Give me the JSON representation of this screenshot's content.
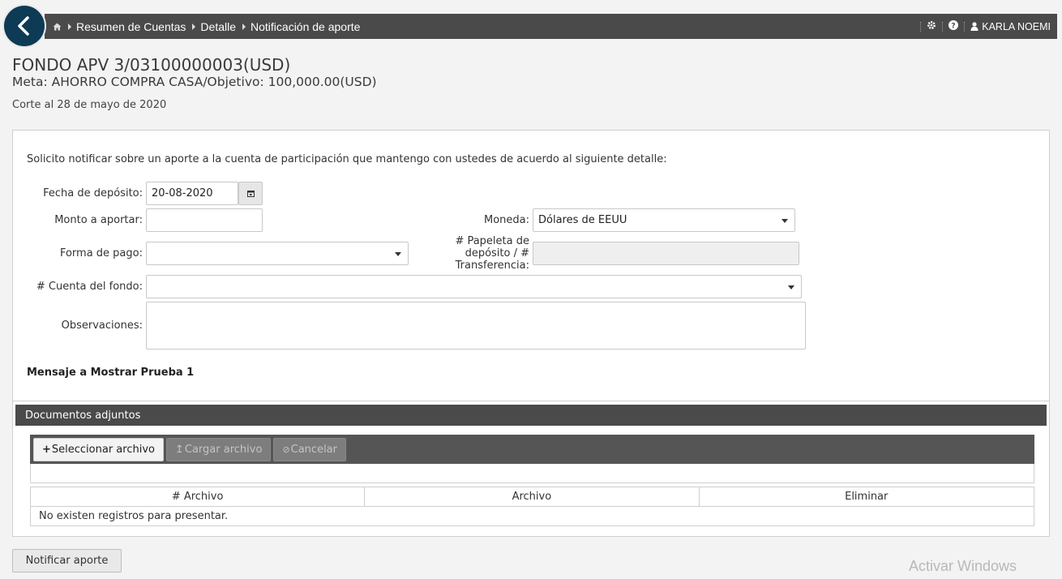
{
  "nav": {
    "breadcrumbs": [
      "Resumen de Cuentas",
      "Detalle",
      "Notificación de aporte"
    ],
    "user_name": "KARLA NOEMI"
  },
  "header": {
    "fund_title": "FONDO APV 3/03100000003(USD)",
    "goal_line": "Meta: AHORRO COMPRA CASA/Objetivo: 100,000.00(USD)",
    "cut_date": "Corte al 28 de mayo de 2020"
  },
  "form": {
    "intro": "Solicito notificar sobre un aporte a la cuenta de participación que mantengo con ustedes de acuerdo al siguiente detalle:",
    "deposit_date_label": "Fecha de depósito:",
    "deposit_date_value": "20-08-2020",
    "amount_label": "Monto a aportar:",
    "amount_value": "",
    "currency_label": "Moneda:",
    "currency_value": "Dólares de EEUU",
    "payment_label": "Forma de pago:",
    "payment_value": "",
    "slip_label_1": "# Papeleta de",
    "slip_label_2": "depósito / #",
    "slip_label_3": "Transferencia:",
    "slip_value": "",
    "fund_account_label": "# Cuenta del fondo:",
    "fund_account_value": "",
    "notes_label": "Observaciones:",
    "notes_value": "",
    "message": "Mensaje a Mostrar Prueba 1"
  },
  "attachments": {
    "title": "Documentos adjuntos",
    "select_button": "Seleccionar archivo",
    "upload_button": "Cargar archivo",
    "cancel_button": "Cancelar",
    "columns": [
      "# Archivo",
      "Archivo",
      "Eliminar"
    ],
    "empty_message": "No existen registros para presentar."
  },
  "actions": {
    "submit_label": "Notificar aporte"
  },
  "watermark": "Activar Windows",
  "colors": {
    "nav_bar": "#4a4a4a",
    "back_button": "#0d3a55",
    "page_bg": "#f3f3f3"
  }
}
